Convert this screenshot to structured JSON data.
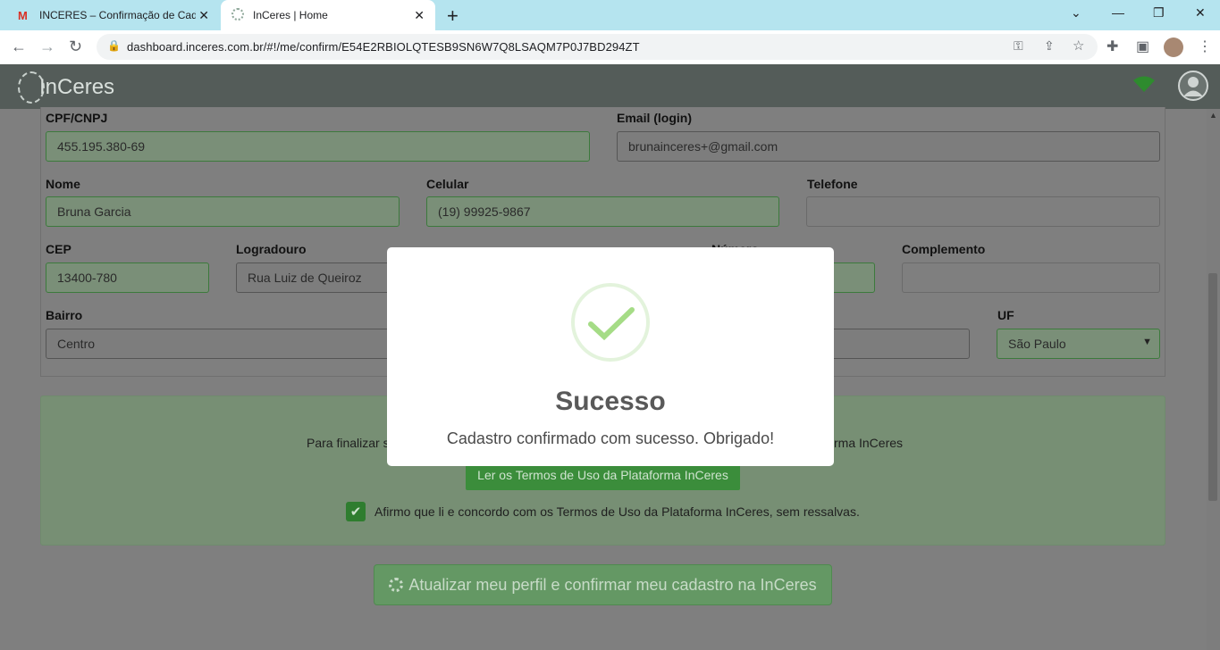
{
  "browser": {
    "tabs": [
      {
        "title": "INCERES – Confirmação de Cada",
        "icon": "gmail-icon"
      },
      {
        "title": "InCeres | Home",
        "icon": "inceres-icon"
      }
    ],
    "url": "dashboard.inceres.com.br/#!/me/confirm/E54E2RBIOLQTESB9SN6W7Q8LSAQM7P0J7BD294ZT"
  },
  "app": {
    "logo_text": "InCeres"
  },
  "form": {
    "cpf_label": "CPF/CNPJ",
    "cpf_value": "455.195.380-69",
    "email_label": "Email (login)",
    "email_value": "brunainceres+@gmail.com",
    "nome_label": "Nome",
    "nome_value": "Bruna Garcia",
    "celular_label": "Celular",
    "celular_value": "(19) 99925-9867",
    "telefone_label": "Telefone",
    "telefone_value": "",
    "cep_label": "CEP",
    "cep_value": "13400-780",
    "logradouro_label": "Logradouro",
    "logradouro_value": "Rua Luiz de Queiroz",
    "numero_label": "Número",
    "numero_value": "",
    "complemento_label": "Complemento",
    "complemento_value": "",
    "bairro_label": "Bairro",
    "bairro_value": "Centro",
    "cidade_value": "",
    "uf_label": "UF",
    "uf_value": "São Paulo"
  },
  "terms": {
    "intro_left": "Para finalizar s",
    "intro_right": "rma InCeres",
    "read_button": "Ler os Termos de Uso da Plataforma InCeres",
    "agree_text": "Afirmo que li e concordo com os Termos de Uso da Plataforma InCeres, sem ressalvas.",
    "agree_checked": true
  },
  "submit_button": "Atualizar meu perfil e confirmar meu cadastro na InCeres",
  "modal": {
    "title": "Sucesso",
    "message": "Cadastro confirmado com sucesso. Obrigado!"
  },
  "colors": {
    "accent": "#3b8d3b",
    "appbar": "#545c59",
    "tabbar": "#b5e4ef"
  }
}
